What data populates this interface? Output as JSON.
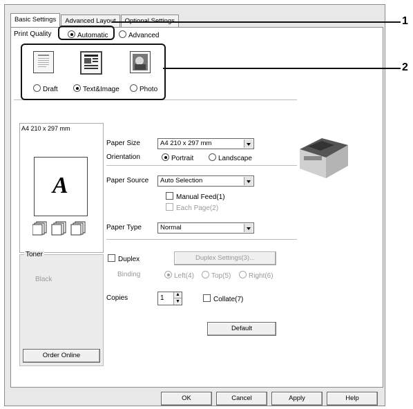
{
  "tabs": [
    "Basic Settings",
    "Advanced Layout",
    "Optional Settings"
  ],
  "print_quality": {
    "label": "Print Quality",
    "automatic": "Automatic",
    "advanced": "Advanced",
    "modes": [
      "Draft",
      "Text&Image",
      "Photo"
    ]
  },
  "preview": {
    "page_label": "A4 210 x 297 mm",
    "glyph": "A"
  },
  "toner": {
    "title": "Toner",
    "color": "Black",
    "order_button": "Order Online"
  },
  "paper_size": {
    "label": "Paper Size",
    "value": "A4 210 x 297 mm"
  },
  "orientation": {
    "label": "Orientation",
    "portrait": "Portrait",
    "landscape": "Landscape"
  },
  "paper_source": {
    "label": "Paper Source",
    "value": "Auto Selection",
    "manual_feed": "Manual Feed(1)",
    "each_page": "Each Page(2)"
  },
  "paper_type": {
    "label": "Paper Type",
    "value": "Normal"
  },
  "duplex": {
    "label": "Duplex",
    "settings_button": "Duplex Settings(3)...",
    "binding_label": "Binding",
    "left": "Left(4)",
    "top": "Top(5)",
    "right": "Right(6)"
  },
  "copies": {
    "label": "Copies",
    "value": "1",
    "collate": "Collate(7)"
  },
  "default_button": "Default",
  "footer": {
    "ok": "OK",
    "cancel": "Cancel",
    "apply": "Apply",
    "help": "Help"
  },
  "callouts": [
    "1",
    "2"
  ]
}
